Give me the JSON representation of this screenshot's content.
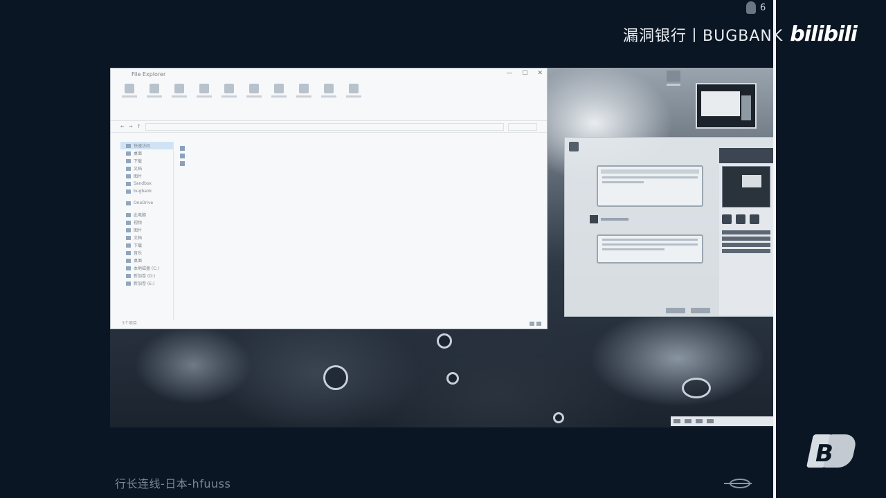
{
  "overlay": {
    "viewer_count": "6",
    "brand_title": "漏洞银行丨BUGBANK",
    "platform_logo": "bilibili",
    "caption": "行长连线-日本-hfuuss",
    "corner_logo": "B"
  },
  "explorer": {
    "title": "File Explorer",
    "window_controls": [
      "—",
      "☐",
      "✕"
    ],
    "status": "3个项目",
    "nav_items": [
      {
        "label": "快速访问",
        "icon": "star-icon"
      },
      {
        "label": "桌面",
        "icon": "desktop-icon"
      },
      {
        "label": "下载",
        "icon": "download-icon"
      },
      {
        "label": "文档",
        "icon": "document-icon"
      },
      {
        "label": "图片",
        "icon": "picture-icon"
      },
      {
        "label": "Sandbox",
        "icon": "folder-icon"
      },
      {
        "label": "bugbank",
        "icon": "folder-icon"
      },
      {
        "label": "OneDrive",
        "icon": "cloud-icon"
      },
      {
        "label": "此电脑",
        "icon": "computer-icon"
      },
      {
        "label": "视频",
        "icon": "video-icon"
      },
      {
        "label": "图片",
        "icon": "picture-icon"
      },
      {
        "label": "文档",
        "icon": "document-icon"
      },
      {
        "label": "下载",
        "icon": "download-icon"
      },
      {
        "label": "音乐",
        "icon": "music-icon"
      },
      {
        "label": "桌面",
        "icon": "desktop-icon"
      },
      {
        "label": "本地磁盘 (C:)",
        "icon": "drive-icon"
      },
      {
        "label": "新加卷 (D:)",
        "icon": "drive-icon"
      },
      {
        "label": "新加卷 (E:)",
        "icon": "drive-icon"
      }
    ]
  },
  "colors": {
    "background": "#0b1624",
    "accent_light": "#f2f4f6"
  }
}
